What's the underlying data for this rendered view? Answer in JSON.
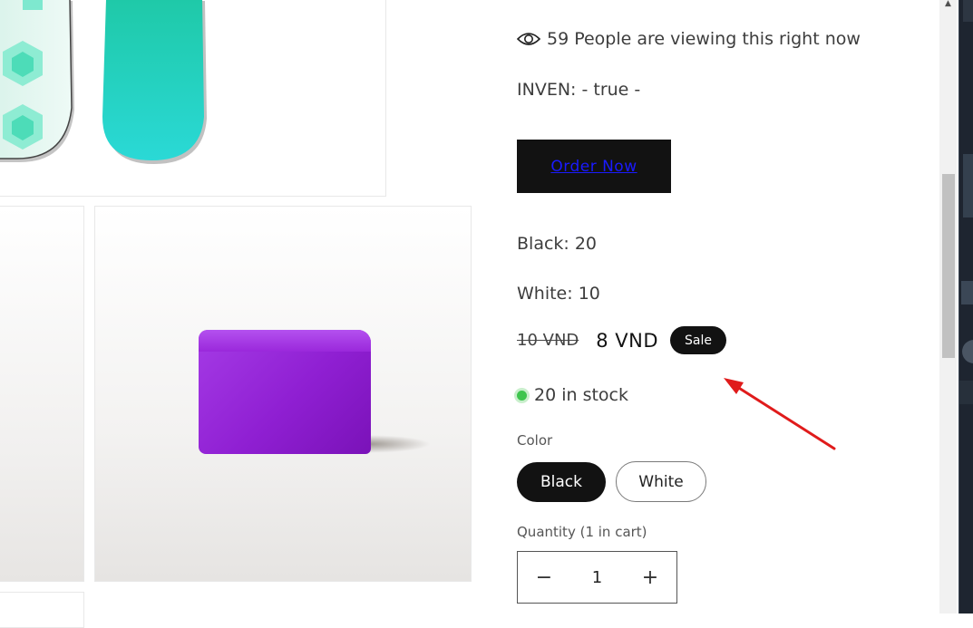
{
  "viewing": {
    "count": "59",
    "text": "59 People are viewing this right now"
  },
  "inventory_text": "INVEN: - true -",
  "order_button_label": "Order Now",
  "variant_stock": [
    {
      "label": "Black: 20"
    },
    {
      "label": "White: 10"
    }
  ],
  "price": {
    "regular": "10 VND",
    "sale": "8 VND",
    "badge": "Sale"
  },
  "stock": {
    "text": "20 in stock",
    "status_color": "#3ec54e"
  },
  "color_option": {
    "label": "Color",
    "options": [
      "Black",
      "White"
    ],
    "selected": "Black"
  },
  "quantity": {
    "label": "Quantity (1 in cart)",
    "value": "1",
    "decrease_symbol": "−",
    "increase_symbol": "+"
  },
  "colors": {
    "accent_dark": "#121212",
    "annotation_arrow": "#e01b1b",
    "in_stock": "#3ec54e",
    "soap": "#9a28db",
    "snowboard": "#2dd8c8"
  }
}
